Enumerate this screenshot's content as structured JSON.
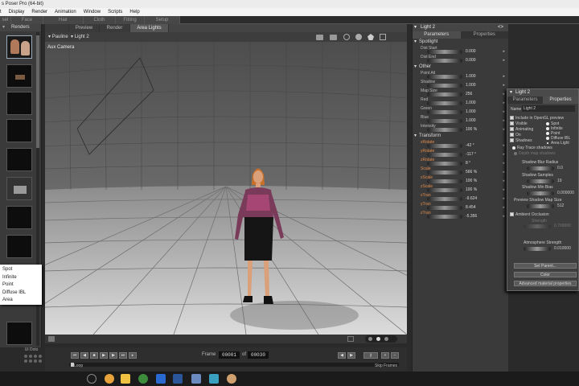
{
  "window": {
    "title": "s Poser Pro (64-bit)"
  },
  "menu": [
    "t",
    "Display",
    "Render",
    "Animation",
    "Window",
    "Scripts",
    "Help"
  ],
  "room_tabs": [
    "sel",
    "Face",
    "Hair",
    "Cloth",
    "Fitting",
    "Setup"
  ],
  "renders_panel": {
    "title": "Renders"
  },
  "light_type_menu": [
    "Spot",
    "Infinite",
    "Point",
    "Diffuse IBL",
    "Area"
  ],
  "viewport_tabs": [
    "Preview",
    "Render",
    "Area Lights"
  ],
  "viewport_bar": {
    "figure": "Pauline",
    "actor": "Light 2"
  },
  "viewport": {
    "camera": "Aux Camera"
  },
  "ui_dots": "UI Dots",
  "animation": {
    "frame_label": "Frame",
    "frame": "00001",
    "of": "of",
    "total": "00030",
    "loop": "Loop",
    "skip_frames": "Skip Frames"
  },
  "params": {
    "title": "Light 2",
    "tabs": [
      "Parameters",
      "Properties"
    ],
    "spotlight_group": "Spotlight",
    "spotlight": [
      {
        "label": "Dist Start",
        "value": "0.000"
      },
      {
        "label": "Dist End",
        "value": "0.000"
      }
    ],
    "other_group": "Other",
    "other": [
      {
        "label": "Point Atl",
        "value": "1.000"
      },
      {
        "label": "Shadow",
        "value": "1.000"
      },
      {
        "label": "Map Size",
        "value": "256"
      },
      {
        "label": "Red",
        "value": "1.000"
      },
      {
        "label": "Green",
        "value": "1.000"
      },
      {
        "label": "Blue",
        "value": "1.000"
      },
      {
        "label": "Intensity",
        "value": "100 %"
      }
    ],
    "transform_group": "Transform",
    "transform": [
      {
        "label": "xRotate",
        "value": "-42 °"
      },
      {
        "label": "yRotate",
        "value": "-117 °"
      },
      {
        "label": "zRotate",
        "value": "8 °"
      },
      {
        "label": "Scale",
        "value": "566 %"
      },
      {
        "label": "xScale",
        "value": "100 %"
      },
      {
        "label": "zScale",
        "value": "100 %"
      },
      {
        "label": "xTran",
        "value": "-9.624"
      },
      {
        "label": "yTran",
        "value": "8.454"
      },
      {
        "label": "zTran",
        "value": "-5.356"
      }
    ]
  },
  "props": {
    "title": "Light 2",
    "tabs": [
      "Parameters",
      "Properties"
    ],
    "name_label": "Name",
    "name_value": "Light 2",
    "checks": [
      "Include in OpenGL preview",
      "Visible",
      "Animating",
      "On",
      "Shadows"
    ],
    "types": [
      "Spot",
      "Infinite",
      "Point",
      "Diffuse IBL",
      "Area Light"
    ],
    "ray_trace": "Ray Trace shadows",
    "depth_map": "Depth map shadows",
    "shadow_blur_label": "Shadow Blur Radius",
    "shadow_blur": "0.0",
    "shadow_samples_label": "Shadow Samples",
    "shadow_samples": "19",
    "shadow_min_bias_label": "Shadow Min Bias",
    "shadow_min_bias": "0.000000",
    "preview_map_label": "Preview Shadow Map Size",
    "preview_map": "512",
    "ambient_occlusion": "Ambient Occlusion",
    "strength_label": "Strength",
    "strength": "0.700000",
    "atmosphere_label": "Atmosphere Strength",
    "atmosphere": "0.010000",
    "set_parent": "Set Parent...",
    "color": "Color",
    "advanced": "Advanced material properties"
  }
}
